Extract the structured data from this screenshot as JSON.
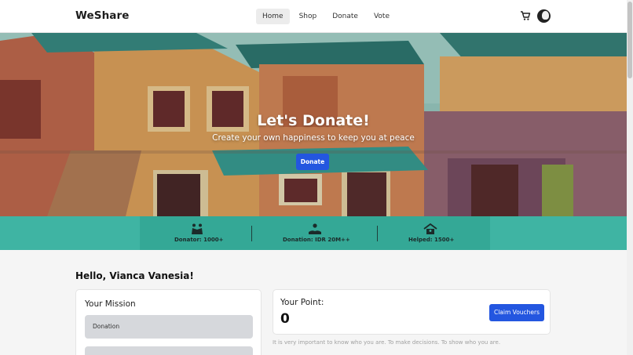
{
  "navbar": {
    "brand": "WeShare",
    "links": [
      "Home",
      "Shop",
      "Donate",
      "Vote"
    ],
    "active": "Home"
  },
  "hero": {
    "title": "Let's Donate!",
    "subtitle": "Create your own happiness to keep you at peace",
    "button_label": "Donate"
  },
  "stats": [
    {
      "icon": "people-hug-icon",
      "label": "Donator: 1000+"
    },
    {
      "icon": "donation-hand-icon",
      "label": "Donation: IDR 20M++"
    },
    {
      "icon": "shelter-icon",
      "label": "Helped: 1500+"
    }
  ],
  "greeting": "Hello, Vianca Vanesia!",
  "mission": {
    "title": "Your Mission",
    "items": [
      "Donation",
      ""
    ]
  },
  "points": {
    "title": "Your Point:",
    "value": "0",
    "claim_label": "Claim Vouchers"
  },
  "quote": "It is very important to know who you are. To make decisions. To show who you are.",
  "colors": {
    "accent": "#2356e0",
    "stats_band": "#3fb4a3"
  }
}
